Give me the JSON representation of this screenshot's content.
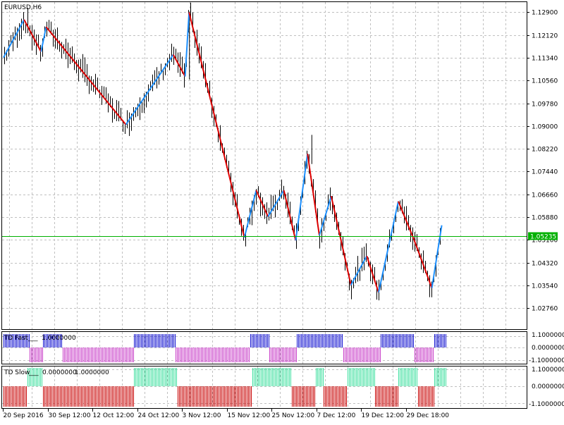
{
  "window": {
    "symbol_label": "EURUSD,H6"
  },
  "colors": {
    "background": "#ffffff",
    "grid": "#c0c0c0",
    "bars": "#000000",
    "zigzag_up": "#1e90ff",
    "zigzag_down": "#dc0000",
    "price_line": "#00b000",
    "fast_positive": "#1010d0",
    "fast_negative": "#c83cc8",
    "slow_positive": "#40e0a0",
    "slow_negative": "#c80000"
  },
  "price_axis": {
    "labels": [
      "1.12900",
      "1.12120",
      "1.11340",
      "1.10560",
      "1.09780",
      "1.09000",
      "1.08220",
      "1.07440",
      "1.06660",
      "1.05880",
      "1.05100",
      "1.04320",
      "1.03540",
      "1.02760"
    ],
    "range": [
      1.0204,
      1.1325
    ],
    "current_price": "1.05235",
    "current_price_value": 1.05235
  },
  "time_axis": {
    "labels": [
      "20 Sep 2016",
      "30 Sep 12:00",
      "12 Oct 12:00",
      "24 Oct 12:00",
      "3 Nov 12:00",
      "15 Nov 12:00",
      "25 Nov 12:00",
      "7 Dec 12:00",
      "19 Dec 12:00",
      "29 Dec 18:00"
    ]
  },
  "indicators": {
    "td_fast": {
      "title": "TD Fast",
      "value_label": "1.0000000",
      "axis_labels": [
        "1.1000000",
        "0.0000000",
        "-1.1000000"
      ]
    },
    "td_slow": {
      "title": "TD Slow",
      "value_label_1": "0.0000000",
      "value_label_2": "1.0000000",
      "axis_labels": [
        "1.1000000",
        "0.0000000",
        "-1.1000000"
      ]
    }
  },
  "chart_data": {
    "type": "line",
    "symbol": "EURUSD",
    "timeframe": "H6",
    "zigzag_points": [
      {
        "t": 0.0,
        "price": 1.1135
      },
      {
        "t": 0.052,
        "price": 1.1265
      },
      {
        "t": 0.095,
        "price": 1.1155
      },
      {
        "t": 0.108,
        "price": 1.124
      },
      {
        "t": 0.31,
        "price": 1.0905
      },
      {
        "t": 0.43,
        "price": 1.1145
      },
      {
        "t": 0.46,
        "price": 1.107
      },
      {
        "t": 0.47,
        "price": 1.129
      },
      {
        "t": 0.61,
        "price": 1.0518
      },
      {
        "t": 0.64,
        "price": 1.068
      },
      {
        "t": 0.67,
        "price": 1.059
      },
      {
        "t": 0.71,
        "price": 1.068
      },
      {
        "t": 0.74,
        "price": 1.0508
      },
      {
        "t": 0.77,
        "price": 1.0805
      },
      {
        "t": 0.8,
        "price": 1.0525
      },
      {
        "t": 0.83,
        "price": 1.066
      },
      {
        "t": 0.88,
        "price": 1.0355
      },
      {
        "t": 0.92,
        "price": 1.0455
      },
      {
        "t": 0.95,
        "price": 1.033
      },
      {
        "t": 1.0,
        "price": 1.0642
      }
    ],
    "zigzag_points_continued": [
      {
        "t": 1.04,
        "price": 1.051
      },
      {
        "t": 1.085,
        "price": 1.0345
      },
      {
        "t": 1.11,
        "price": 1.056
      }
    ],
    "td_fast_segments": [
      {
        "from": 0.0,
        "to": 0.065,
        "value": 1
      },
      {
        "from": 0.065,
        "to": 0.1,
        "value": -1
      },
      {
        "from": 0.1,
        "to": 0.15,
        "value": 1
      },
      {
        "from": 0.15,
        "to": 0.33,
        "value": -1
      },
      {
        "from": 0.33,
        "to": 0.435,
        "value": 1
      },
      {
        "from": 0.435,
        "to": 0.625,
        "value": -1
      },
      {
        "from": 0.625,
        "to": 0.672,
        "value": 1
      },
      {
        "from": 0.672,
        "to": 0.742,
        "value": -1
      },
      {
        "from": 0.742,
        "to": 0.86,
        "value": 1
      },
      {
        "from": 0.86,
        "to": 0.955,
        "value": -1
      },
      {
        "from": 0.955,
        "to": 1.04,
        "value": 1
      },
      {
        "from": 1.04,
        "to": 1.09,
        "value": -1
      },
      {
        "from": 1.09,
        "to": 1.12,
        "value": 1
      }
    ],
    "td_slow_segments": [
      {
        "from": 0.0,
        "to": 0.06,
        "value": -1
      },
      {
        "from": 0.06,
        "to": 0.1,
        "value": 1
      },
      {
        "from": 0.1,
        "to": 0.33,
        "value": -1
      },
      {
        "from": 0.33,
        "to": 0.44,
        "value": 1
      },
      {
        "from": 0.44,
        "to": 0.63,
        "value": -1
      },
      {
        "from": 0.63,
        "to": 0.73,
        "value": 1
      },
      {
        "from": 0.73,
        "to": 0.79,
        "value": -1
      },
      {
        "from": 0.79,
        "to": 0.81,
        "value": 1
      },
      {
        "from": 0.81,
        "to": 0.87,
        "value": -1
      },
      {
        "from": 0.87,
        "to": 0.94,
        "value": 1
      },
      {
        "from": 0.94,
        "to": 1.0,
        "value": -1
      },
      {
        "from": 1.0,
        "to": 1.05,
        "value": 1
      },
      {
        "from": 1.05,
        "to": 1.09,
        "value": -1
      },
      {
        "from": 1.09,
        "to": 1.12,
        "value": 1
      }
    ]
  }
}
